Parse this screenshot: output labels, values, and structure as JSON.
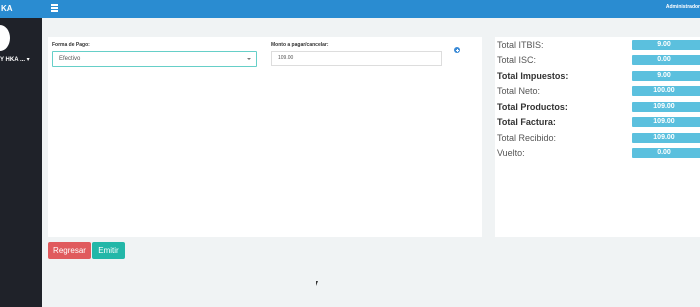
{
  "sidebar": {
    "brand": "KA",
    "user_name": "Y HKA ... ▾"
  },
  "header": {
    "menu_icon": "hamburger-icon",
    "user": "Administrador"
  },
  "payment": {
    "method_label": "Forma de Pago:",
    "method_value": "Efectivo",
    "amount_label": "Monto a pagar/cancelar:",
    "amount_value": "109.00",
    "add_icon": "plus-circle-icon"
  },
  "totals": [
    {
      "label": "Total ITBIS:",
      "value": "9.00",
      "bold": false
    },
    {
      "label": "Total ISC:",
      "value": "0.00",
      "bold": false
    },
    {
      "label": "Total Impuestos:",
      "value": "9.00",
      "bold": true
    },
    {
      "label": "Total Neto:",
      "value": "100.00",
      "bold": false
    },
    {
      "label": "Total Productos:",
      "value": "109.00",
      "bold": true
    },
    {
      "label": "Total Factura:",
      "value": "109.00",
      "bold": true
    },
    {
      "label": "Total Recibido:",
      "value": "109.00",
      "bold": false
    },
    {
      "label": "Vuelto:",
      "value": "0.00",
      "bold": false
    }
  ],
  "actions": {
    "back": "Regresar",
    "emit": "Emitir"
  },
  "colors": {
    "primary": "#2a8cd1",
    "sidebar": "#1f2229",
    "badge": "#5bc0de",
    "danger": "#e05a5d",
    "success": "#23b7a8"
  }
}
